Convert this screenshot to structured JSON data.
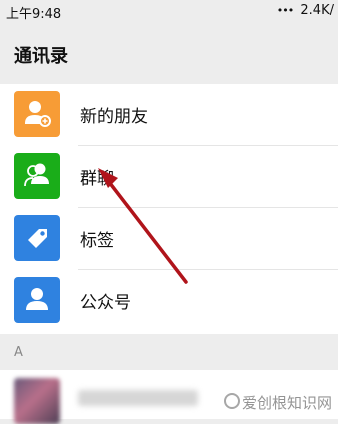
{
  "status_bar": {
    "time": "上午9:48",
    "network_speed": "2.4K/",
    "dots": "•••"
  },
  "header": {
    "title": "通讯录"
  },
  "menu": {
    "items": [
      {
        "label": "新的朋友",
        "icon": "add-friend-icon",
        "color": "#f79c36"
      },
      {
        "label": "群聊",
        "icon": "group-chat-icon",
        "color": "#1aad19"
      },
      {
        "label": "标签",
        "icon": "tag-icon",
        "color": "#2f82e0"
      },
      {
        "label": "公众号",
        "icon": "official-account-icon",
        "color": "#2f82e0"
      }
    ]
  },
  "section": {
    "letter": "A"
  },
  "watermark": {
    "text": "爱创根知识网"
  },
  "annotation": {
    "arrow_color": "#b0141b"
  }
}
